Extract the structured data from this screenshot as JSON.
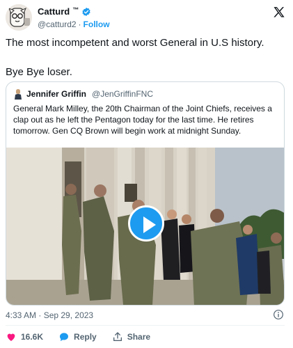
{
  "tweet": {
    "author": {
      "display_name": "Catturd",
      "tm": "™",
      "handle": "@catturd2",
      "separator": "·",
      "follow_label": "Follow"
    },
    "text_line1": "The most incompetent and worst General in U.S history.",
    "text_line2": "Bye Bye loser.",
    "quoted": {
      "display_name": "Jennifer Griffin",
      "handle": "@JenGriffinFNC",
      "text": "General Mark Milley, the 20th Chairman of the Joint Chiefs, receives a clap out as he left the Pentagon today for the last time. He retires tomorrow. Gen CQ Brown will begin work at midnight Sunday."
    },
    "timestamp": "4:33 AM · Sep 29, 2023",
    "actions": {
      "likes": "16.6K",
      "reply_label": "Reply",
      "share_label": "Share"
    }
  },
  "colors": {
    "accent": "#1d9bf0",
    "like": "#f91880",
    "secondary_text": "#536471",
    "border": "#cfd9de"
  },
  "icons": [
    "verified-badge-icon",
    "x-logo-icon",
    "play-icon",
    "info-icon",
    "heart-icon",
    "reply-icon",
    "share-icon"
  ]
}
